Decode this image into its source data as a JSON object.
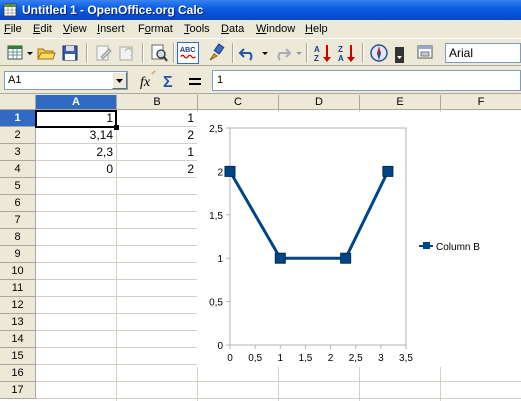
{
  "window": {
    "title": "Untitled 1 - OpenOffice.org Calc"
  },
  "menu": [
    {
      "label": "File",
      "ul": "F",
      "rest": "ile"
    },
    {
      "label": "Edit",
      "ul": "E",
      "rest": "dit"
    },
    {
      "label": "View",
      "ul": "V",
      "rest": "iew"
    },
    {
      "label": "Insert",
      "ul": "I",
      "rest": "nsert"
    },
    {
      "label": "Format",
      "pre": "F",
      "ul": "o",
      "rest": "rmat"
    },
    {
      "label": "Tools",
      "ul": "T",
      "rest": "ools"
    },
    {
      "label": "Data",
      "ul": "D",
      "rest": "ata"
    },
    {
      "label": "Window",
      "ul": "W",
      "rest": "indow"
    },
    {
      "label": "Help",
      "ul": "H",
      "rest": "elp"
    }
  ],
  "toolbar": {
    "font_name": "Arial"
  },
  "formula_bar": {
    "cell_ref": "A1",
    "content": "1"
  },
  "sheet": {
    "columns": [
      "A",
      "B",
      "C",
      "D",
      "E",
      "F"
    ],
    "active_column": "A",
    "rows": [
      "1",
      "2",
      "3",
      "4",
      "5",
      "6",
      "7",
      "8",
      "9",
      "10",
      "11",
      "12",
      "13",
      "14",
      "15",
      "16",
      "17"
    ],
    "active_row": "1",
    "cells": {
      "A": [
        "1",
        "3,14",
        "2,3",
        "0"
      ],
      "B": [
        "1",
        "2",
        "1",
        "2"
      ]
    }
  },
  "chart_data": {
    "type": "line",
    "x": [
      0,
      1,
      2.3,
      3.14
    ],
    "series": [
      {
        "name": "Column B",
        "values": [
          2,
          1,
          1,
          2
        ]
      }
    ],
    "xlim": [
      0,
      3.5
    ],
    "ylim": [
      0,
      2.5
    ],
    "x_ticks": [
      "0",
      "0,5",
      "1",
      "1,5",
      "2",
      "2,5",
      "3",
      "3,5"
    ],
    "y_ticks": [
      "0",
      "0,5",
      "1",
      "1,5",
      "2",
      "2,5"
    ],
    "legend_position": "right",
    "grid": false,
    "color": "#004586"
  }
}
